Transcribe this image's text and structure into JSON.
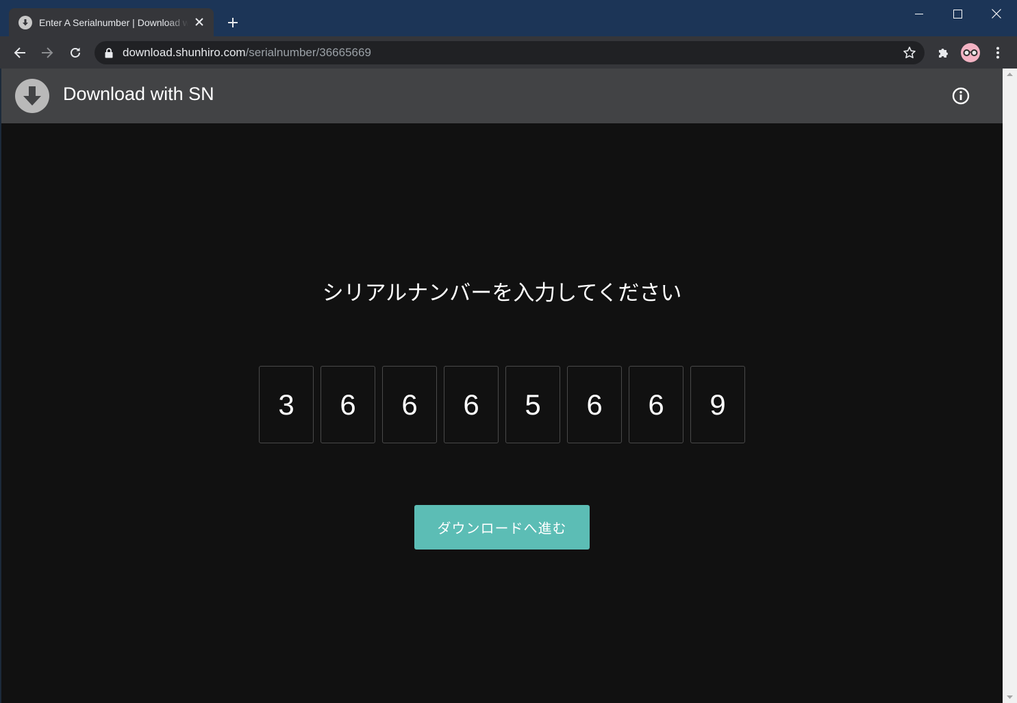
{
  "browser": {
    "tab_title": "Enter A Serialnumber | Download with SN",
    "url_host": "download.shunhiro.com",
    "url_path": "/serialnumber/36665669"
  },
  "app": {
    "title": "Download with SN"
  },
  "main": {
    "prompt": "シリアルナンバーを入力してください",
    "digits": [
      "3",
      "6",
      "6",
      "6",
      "5",
      "6",
      "6",
      "9"
    ],
    "proceed_label": "ダウンロードへ進む"
  },
  "colors": {
    "titlebar": "#1c3557",
    "header": "#424345",
    "background": "#111111",
    "accent": "#5cbdb5"
  }
}
